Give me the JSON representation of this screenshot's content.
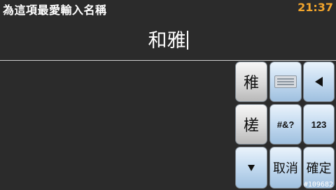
{
  "header": {
    "title": "為這項最愛輸入名稱",
    "clock": "21:37"
  },
  "input": {
    "value": "和雅"
  },
  "keyboard": {
    "candidates": [
      "稚",
      "槎"
    ],
    "symbols_label": "#&?",
    "numbers_label": "123",
    "cancel_label": "取消",
    "confirm_label": "確定",
    "icons": {
      "keyboard": "keyboard-icon",
      "backspace": "backspace-arrow-icon",
      "more": "down-arrow-icon"
    }
  },
  "footer": {
    "build": "#109682"
  },
  "colors": {
    "clock": "#f2a52c",
    "background": "#2b2b2b",
    "key_gray": "#d9d9d9",
    "key_blue": "#c3daf0"
  }
}
